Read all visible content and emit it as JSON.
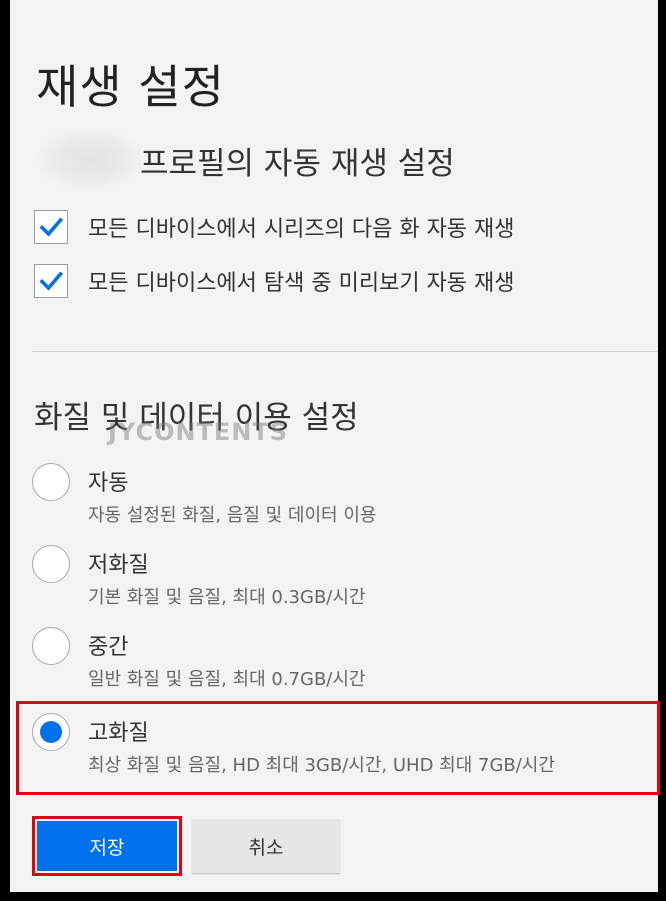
{
  "page": {
    "title": "재생 설정"
  },
  "autoplay": {
    "section_title": "프로필의 자동 재생 설정",
    "options": [
      {
        "label": "모든 디바이스에서 시리즈의 다음 화 자동 재생",
        "checked": true
      },
      {
        "label": "모든 디바이스에서 탐색 중 미리보기 자동 재생",
        "checked": true
      }
    ]
  },
  "quality": {
    "section_title": "화질 및 데이터 이용 설정",
    "watermark": "JYCONTENTS",
    "options": [
      {
        "label": "자동",
        "description": "자동 설정된 화질, 음질 및 데이터 이용",
        "selected": false
      },
      {
        "label": "저화질",
        "description": "기본 화질 및 음질, 최대 0.3GB/시간",
        "selected": false
      },
      {
        "label": "중간",
        "description": "일반 화질 및 음질, 최대 0.7GB/시간",
        "selected": false
      },
      {
        "label": "고화질",
        "description": "최상 화질 및 음질, HD 최대 3GB/시간, UHD 최대 7GB/시간",
        "selected": true
      }
    ]
  },
  "actions": {
    "save_label": "저장",
    "cancel_label": "취소"
  },
  "colors": {
    "accent": "#0071eb",
    "highlight": "#e20013"
  }
}
